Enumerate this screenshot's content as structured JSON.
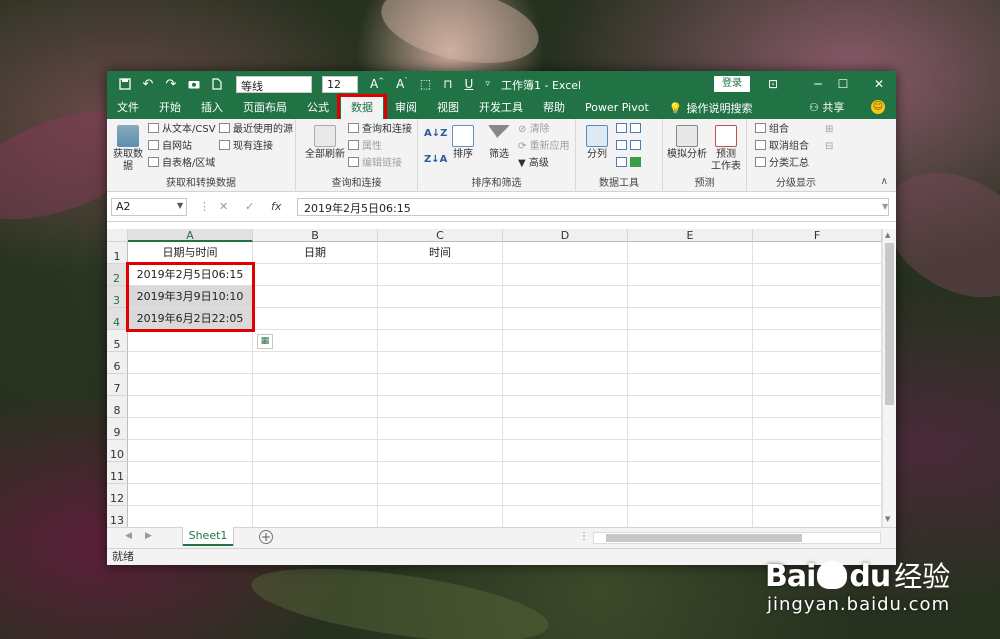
{
  "title_bar": {
    "font_name": "等线",
    "font_size": "12",
    "doc_title": "工作簿1 - Excel",
    "login_label": "登录",
    "quick_access": [
      "save-icon",
      "undo-icon",
      "redo-icon",
      "camera-icon",
      "new-doc-icon"
    ]
  },
  "menu": {
    "tabs": [
      "文件",
      "开始",
      "插入",
      "页面布局",
      "公式",
      "数据",
      "审阅",
      "视图",
      "开发工具",
      "帮助",
      "Power Pivot"
    ],
    "active_tab": "数据",
    "tell_me": "操作说明搜索",
    "share": "共享"
  },
  "ribbon": {
    "get_transform": {
      "label": "获取和转换数据",
      "get_data": "获取数\n据",
      "from_text_csv": "从文本/CSV",
      "from_web": "自网站",
      "from_table": "自表格/区域",
      "recent_sources": "最近使用的源",
      "existing_connections": "现有连接"
    },
    "queries": {
      "label": "查询和连接",
      "refresh_all": "全部刷新",
      "queries_connections": "查询和连接",
      "properties": "属性",
      "edit_links": "编辑链接"
    },
    "sort_filter": {
      "label": "排序和筛选",
      "sort": "排序",
      "filter": "筛选",
      "clear": "清除",
      "reapply": "重新应用",
      "advanced": "高级"
    },
    "data_tools": {
      "label": "数据工具",
      "text_to_columns": "分列"
    },
    "forecast": {
      "label": "预测",
      "what_if": "模拟分析",
      "forecast_sheet": "预测\n工作表"
    },
    "outline": {
      "label": "分级显示",
      "group": "组合",
      "ungroup": "取消组合",
      "subtotal": "分类汇总"
    }
  },
  "formula_bar": {
    "name_box": "A2",
    "formula": "2019年2月5日06:15"
  },
  "sheet": {
    "columns": [
      "A",
      "B",
      "C",
      "D",
      "E",
      "F"
    ],
    "rows": [
      "1",
      "2",
      "3",
      "4",
      "5",
      "6",
      "7",
      "8",
      "9",
      "10",
      "11",
      "12",
      "13"
    ],
    "cells": {
      "A1": "日期与时间",
      "B1": "日期",
      "C1": "时间",
      "A2": "2019年2月5日06:15",
      "A3": "2019年3月9日10:10",
      "A4": "2019年6月2日22:05"
    },
    "tab_name": "Sheet1"
  },
  "status_bar": {
    "status": "就绪"
  },
  "watermark": {
    "brand": "Bai",
    "brand_suffix": "du",
    "cn": "经验",
    "url": "jingyan.baidu.com"
  },
  "colors": {
    "excel_green": "#217346",
    "highlight_red": "#e00000"
  }
}
